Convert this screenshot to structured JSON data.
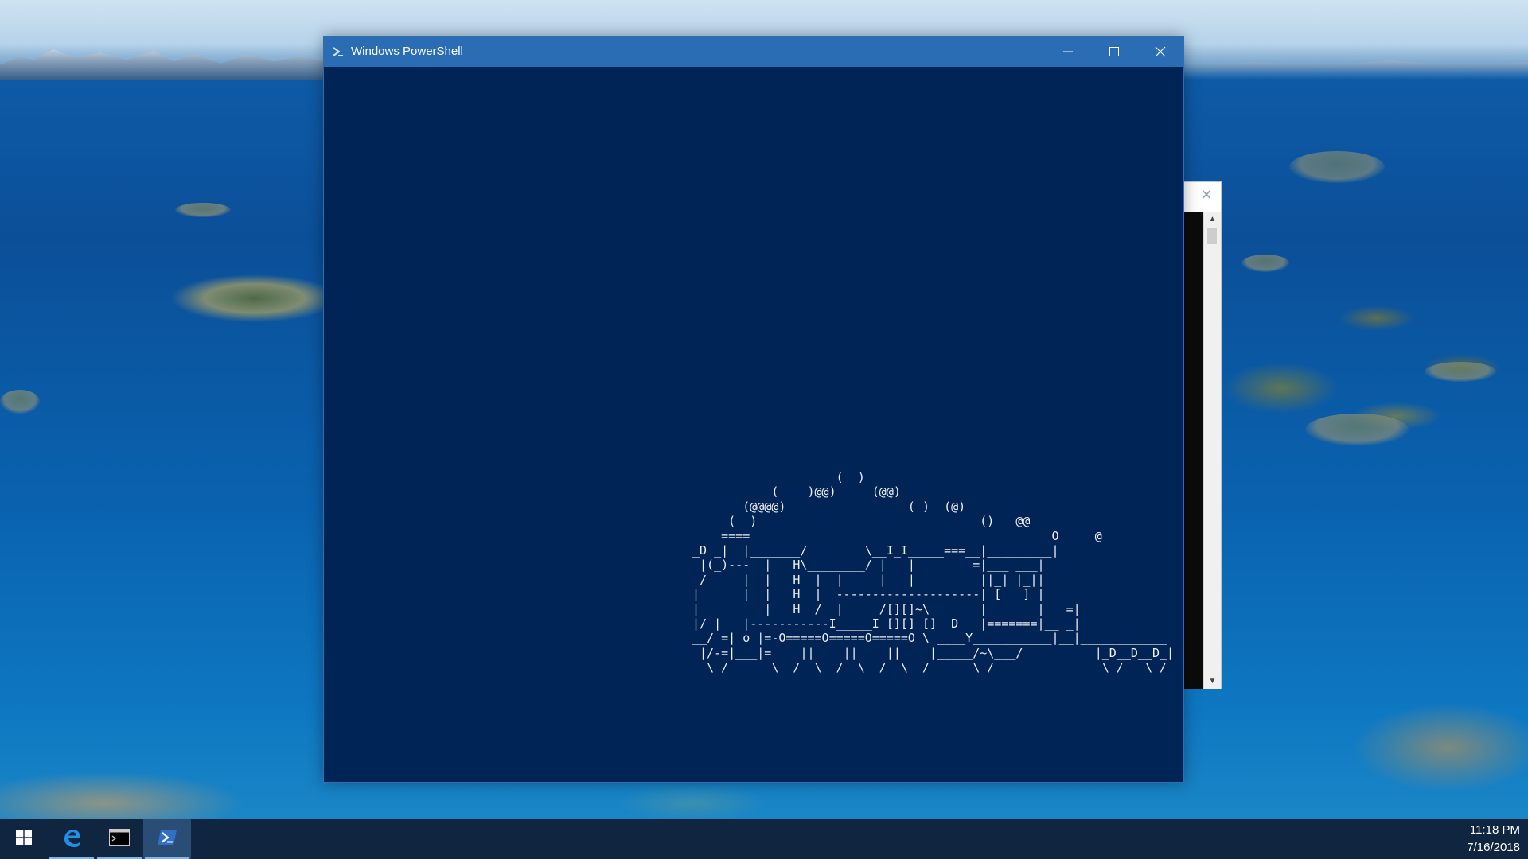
{
  "desktop": {
    "wallpaper": "aerial coastal landscape with islands"
  },
  "background_window": {
    "close_glyph": "✕",
    "scroll_up": "▲",
    "scroll_down": "▼"
  },
  "powershell": {
    "title": "Windows PowerShell",
    "icon": "powershell-icon",
    "controls": {
      "minimize": "minimize-icon",
      "maximize": "maximize-icon",
      "close": "close-icon"
    },
    "console_background": "#012456",
    "console_text_color": "#eeedf0",
    "console_output": [
      "                    (  )",
      "           (    )@@)     (@@)",
      "       (@@@@)                 ( )  (@)",
      "     (  )                               ()   @@",
      "    ====                                          O     @",
      "_D _|  |_______/        \\__I_I_____===__|_________|",
      " |(_)---  |   H\\________/ |   |        =|___ ___|",
      " /     |  |   H  |  |     |   |         ||_| |_||",
      "|      |  |   H  |__--------------------| [___] |      ______________",
      "| ________|___H__/__|_____/[][]~\\_______|       |   =|",
      "|/ |   |-----------I_____I [][] []  D   |=======|__ _|",
      "__/ =| o |=-O=====O=====O=====O \\ ____Y___________|__|____________",
      " |/-=|___|=    ||    ||    ||    |_____/~\\___/          |_D__D__D_|",
      "  \\_/      \\__/  \\__/  \\__/  \\__/      \\_/               \\_/   \\_/"
    ]
  },
  "taskbar": {
    "items": [
      {
        "name": "start",
        "icon": "windows-logo-icon"
      },
      {
        "name": "edge",
        "icon": "edge-icon",
        "running": true
      },
      {
        "name": "command-prompt",
        "icon": "cmd-icon",
        "running": true
      },
      {
        "name": "powershell",
        "icon": "powershell-icon",
        "running": true,
        "active": true
      }
    ],
    "clock": {
      "time": "11:18 PM",
      "date": "7/16/2018"
    }
  }
}
